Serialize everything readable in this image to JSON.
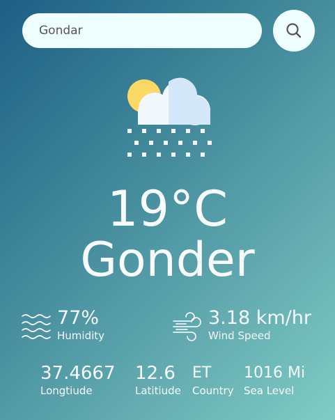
{
  "search": {
    "value": "Gondar",
    "icon": "search-icon"
  },
  "current": {
    "icon": "snow-cloud-sun-icon",
    "temperature": "19°C",
    "city": "Gonder"
  },
  "humidity": {
    "icon": "humidity-waves-icon",
    "value": "77%",
    "label": "Humidity"
  },
  "wind": {
    "icon": "wind-icon",
    "value": "3.18 km/hr",
    "label": "Wind Speed"
  },
  "details": {
    "longitude": {
      "value": "37.4667",
      "label": "Longtiude"
    },
    "latitude": {
      "value": "12.6",
      "label": "Latitiude"
    },
    "country": {
      "value": "ET",
      "label": "Country"
    },
    "sea_level": {
      "value": "1016 Mi",
      "label": "Sea Level"
    }
  },
  "colors": {
    "gradient_start": "#1d5f86",
    "gradient_end": "#7fccc4",
    "input_background": "#efffff",
    "text": "#f7fbfb"
  }
}
